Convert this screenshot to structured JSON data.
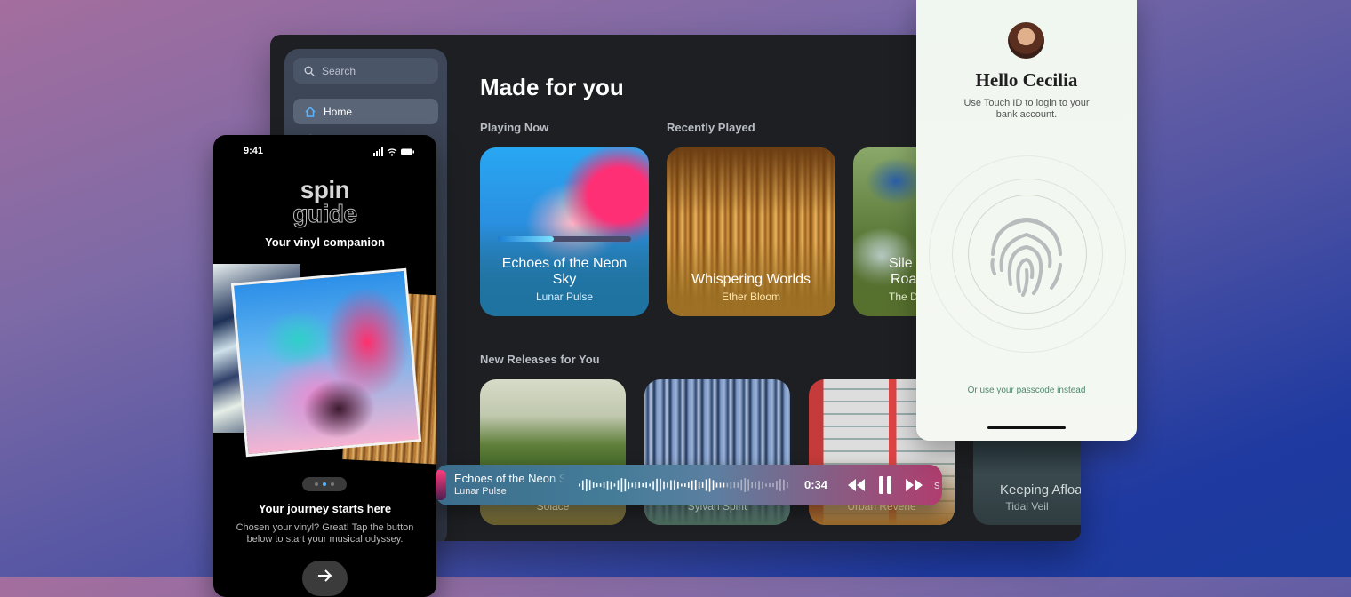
{
  "tablet": {
    "search_placeholder": "Search",
    "nav": [
      {
        "label": "Home"
      }
    ],
    "heading": "Made for you",
    "sections": {
      "playing_now": "Playing Now",
      "recently_played": "Recently Played",
      "new_releases": "New Releases for You"
    },
    "playing_now": {
      "title": "Echoes of the Neon Sky",
      "artist": "Lunar Pulse",
      "progress": 0.42
    },
    "recently_played": [
      {
        "title": "Whispering Worlds",
        "artist": "Ether Bloom"
      },
      {
        "title": "Sile",
        "title_line2": "Roa",
        "artist": "The D"
      }
    ],
    "new_releases": [
      {
        "title": "",
        "artist": "Solace"
      },
      {
        "title": "",
        "artist": "Sylvan Spirit"
      },
      {
        "title": "",
        "artist": "Urban Reverie"
      },
      {
        "title": "Keeping Afloa",
        "artist": "Tidal Veil"
      }
    ]
  },
  "player": {
    "title": "Echoes of the Neon Sky",
    "artist": "Lunar Pulse",
    "time": "0:34",
    "progress": 0.42,
    "overlap_text": "s"
  },
  "phone": {
    "time": "9:41",
    "logo_line1": "spin",
    "logo_line2": "guide",
    "tagline": "Your vinyl companion",
    "page_dots": 3,
    "active_dot": 1,
    "heading": "Your journey starts here",
    "description": "Chosen your vinyl? Great! Tap the button below to start your musical odyssey.",
    "button_icon": "arrow-right-icon"
  },
  "login": {
    "greeting": "Hello Cecilia",
    "instruction": "Use Touch ID to login to your bank account.",
    "fallback": "Or use your passcode instead",
    "icon": "fingerprint-icon"
  },
  "colors": {
    "accent_blue": "#29a7f2",
    "accent_pink": "#ff2f75",
    "passcode_green": "#4c8a6a"
  }
}
